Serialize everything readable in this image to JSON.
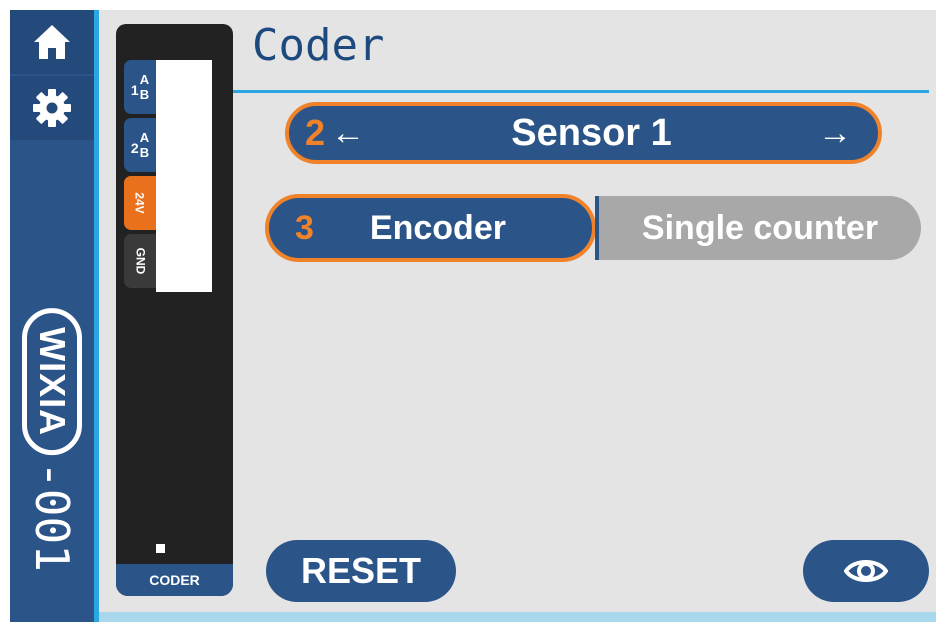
{
  "sidebar": {
    "home_icon": "home-icon",
    "settings_icon": "gear-icon",
    "brand_logo": "WIXIA",
    "brand_suffix": "-001"
  },
  "connector": {
    "pins": [
      {
        "num": "1",
        "a": "A",
        "b": "B"
      },
      {
        "num": "2",
        "a": "A",
        "b": "B"
      },
      {
        "label": "24V"
      },
      {
        "label": "GND"
      }
    ],
    "label": "CODER"
  },
  "page": {
    "title": "Coder"
  },
  "sensor_selector": {
    "step": "2",
    "prev_symbol": "←",
    "label": "Sensor 1",
    "next_symbol": "→"
  },
  "mode": {
    "step": "3",
    "encoder_label": "Encoder",
    "single_label": "Single counter",
    "selected": "Encoder"
  },
  "buttons": {
    "reset_label": "RESET",
    "view_icon": "eye-icon"
  },
  "colors": {
    "primary": "#2b5489",
    "accent": "#f0822a",
    "highlight": "#2aa6e0",
    "inactive": "#a8a8a8"
  }
}
